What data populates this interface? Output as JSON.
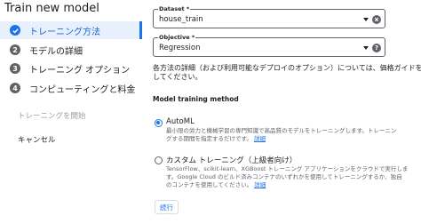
{
  "sidebar": {
    "title": "Train new model",
    "steps": [
      {
        "num": "1",
        "label": "トレーニング方法"
      },
      {
        "num": "2",
        "label": "モデルの詳細"
      },
      {
        "num": "3",
        "label": "トレーニング オプション"
      },
      {
        "num": "4",
        "label": "コンピューティングと料金"
      }
    ],
    "start_label": "トレーニングを開始",
    "cancel_label": "キャンセル"
  },
  "form": {
    "dataset": {
      "label": "Dataset *",
      "value": "house_train"
    },
    "objective": {
      "label": "Objective *",
      "value": "Regression"
    },
    "description": [
      "各方法の詳細（および利用可能なデプロイのオプション）については、価格ガイドを参照",
      "してください。"
    ],
    "method_title": "Model training method",
    "options": [
      {
        "title": "AutoML",
        "desc": [
          "最小限の労力と機械学習の専門知識で高品質のモデルをトレーニングします。トレーニン",
          "グする期間を指定するだけです。"
        ],
        "link": "詳細"
      },
      {
        "title": "カスタム トレーニング（上級者向け）",
        "desc": [
          "TensorFlow、scikit-learn、XGBoost トレーニング アプリケーションをクラウドで実行しま",
          "す。Google Cloud のビルド済みコンテナのいずれかを使用してトレーニングするか、独自",
          "のコンテナを使用してください。"
        ],
        "link": "詳細"
      }
    ],
    "continue_label": "続行"
  },
  "colors": {
    "accent": "#1a73e8",
    "active_bg": "#e8f0fe"
  },
  "icons": {
    "step1": "check-icon",
    "dataset_clear": "clear-icon",
    "objective_help": "help-icon"
  }
}
